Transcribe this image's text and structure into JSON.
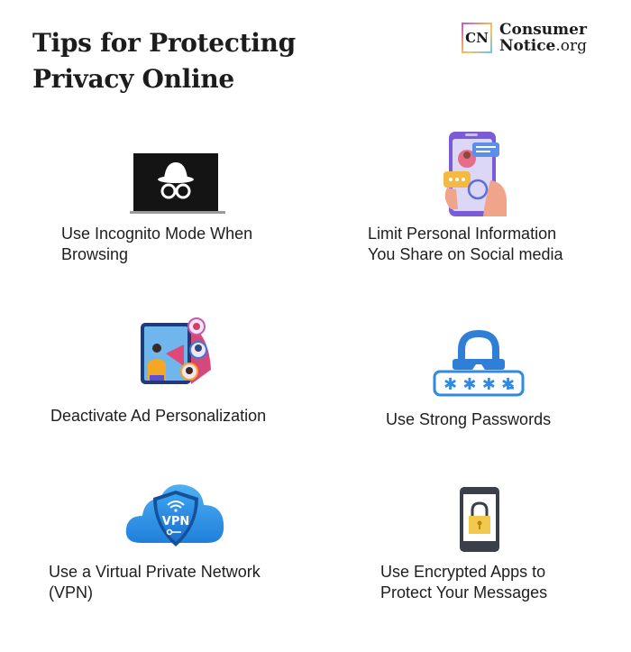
{
  "header": {
    "title_line1": "Tips for Protecting",
    "title_line2": "Privacy Online"
  },
  "logo": {
    "mark": "CN",
    "line1": "Consumer",
    "line2_main": "Notice",
    "line2_suffix": ".org"
  },
  "tips": [
    {
      "id": "incognito",
      "icon": "incognito-laptop-icon",
      "line1": "Use Incognito Mode When",
      "line2": "Browsing"
    },
    {
      "id": "social",
      "icon": "social-media-phone-icon",
      "line1": "Limit Personal Information",
      "line2": "You Share on Social media"
    },
    {
      "id": "ads",
      "icon": "ad-personalization-icon",
      "line1": "Deactivate Ad Personalization",
      "line2": ""
    },
    {
      "id": "passwords",
      "icon": "password-lock-icon",
      "line1": "Use Strong Passwords",
      "line2": ""
    },
    {
      "id": "vpn",
      "icon": "vpn-cloud-icon",
      "line1": "Use a Virtual Private Network",
      "line2": "(VPN)",
      "badge": "VPN"
    },
    {
      "id": "encrypted",
      "icon": "encrypted-phone-icon",
      "line1": "Use Encrypted Apps to",
      "line2": "Protect Your Messages"
    }
  ],
  "colors": {
    "lock_blue": "#2f7fd6",
    "vpn_blue": "#2a8ee6",
    "lock_yellow": "#f2c94c",
    "phone_purple": "#7b5cd6"
  }
}
